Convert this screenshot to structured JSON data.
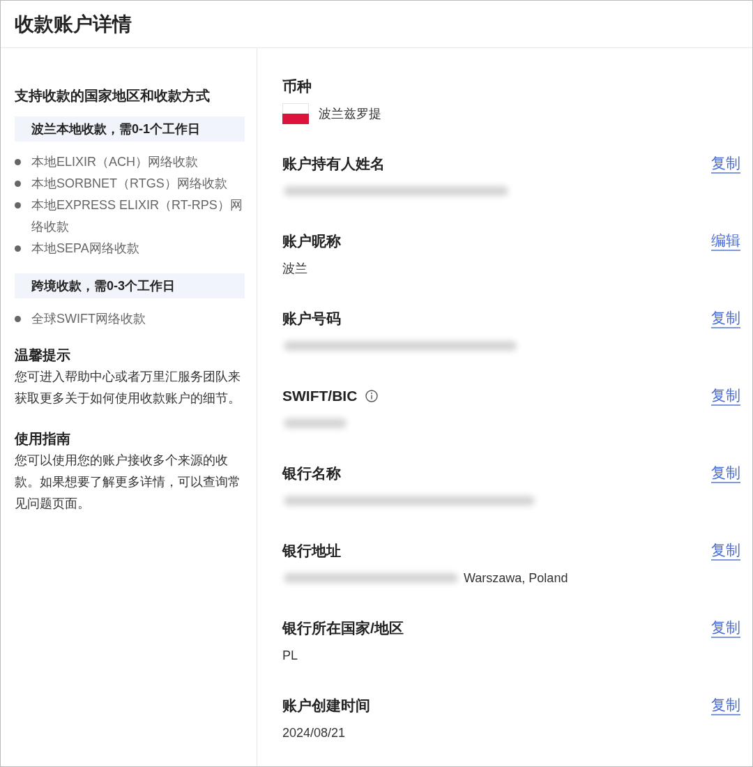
{
  "title": "收款账户详情",
  "sidebar": {
    "heading": "支持收款的国家地区和收款方式",
    "groups": [
      {
        "tag": "波兰本地收款，需0-1个工作日",
        "methods": [
          "本地ELIXIR（ACH）网络收款",
          "本地SORBNET（RTGS）网络收款",
          "本地EXPRESS ELIXIR（RT-RPS）网络收款",
          "本地SEPA网络收款"
        ]
      },
      {
        "tag": "跨境收款，需0-3个工作日",
        "methods": [
          "全球SWIFT网络收款"
        ]
      }
    ],
    "notes": [
      {
        "title": "温馨提示",
        "text": "您可进入帮助中心或者万里汇服务团队来获取更多关于如何使用收款账户的细节。"
      },
      {
        "title": "使用指南",
        "text": "您可以使用您的账户接收多个来源的收款。如果想要了解更多详情，可以查询常见问题页面。"
      }
    ]
  },
  "fields": [
    {
      "label": "币种",
      "kind": "currency",
      "value": "波兰兹罗提"
    },
    {
      "label": "账户持有人姓名",
      "kind": "redacted",
      "action": "复制"
    },
    {
      "label": "账户昵称",
      "kind": "text",
      "value": "波兰",
      "action": "编辑"
    },
    {
      "label": "账户号码",
      "kind": "redacted",
      "action": "复制"
    },
    {
      "label": "SWIFT/BIC",
      "kind": "redacted",
      "info": true,
      "action": "复制"
    },
    {
      "label": "银行名称",
      "kind": "redacted",
      "action": "复制"
    },
    {
      "label": "银行地址",
      "kind": "redacted_text",
      "value": "Warszawa, Poland",
      "action": "复制"
    },
    {
      "label": "银行所在国家/地区",
      "kind": "text",
      "value": "PL",
      "action": "复制"
    },
    {
      "label": "账户创建时间",
      "kind": "text",
      "value": "2024/08/21",
      "action": "复制"
    }
  ]
}
